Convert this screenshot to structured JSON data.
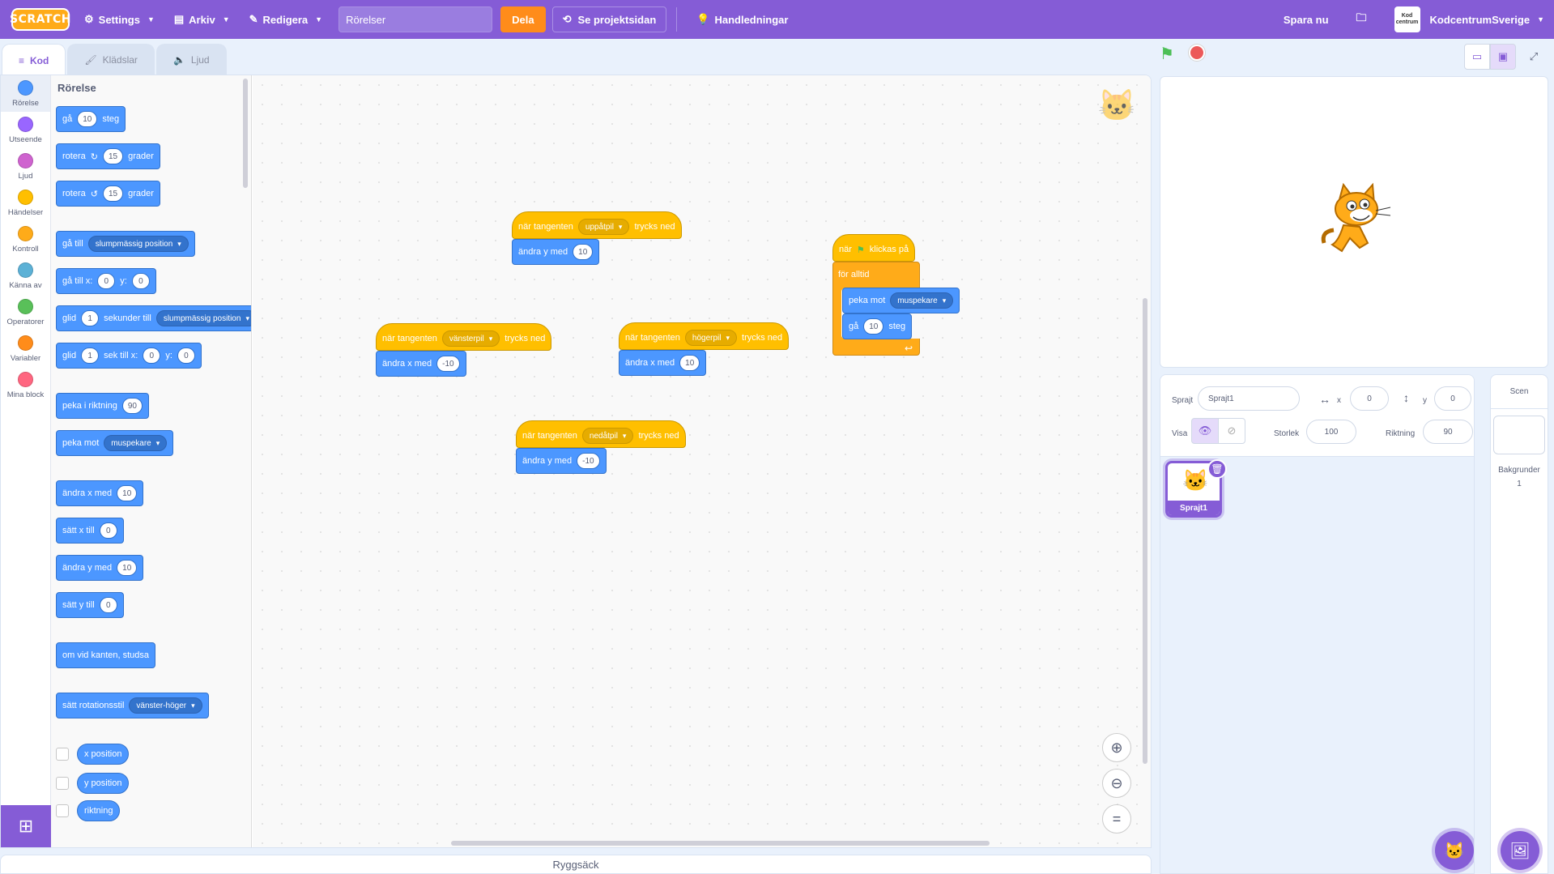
{
  "menubar": {
    "logo": "SCRATCH",
    "settings": "Settings",
    "file": "Arkiv",
    "edit": "Redigera",
    "title_value": "Rörelser",
    "share": "Dela",
    "project_page": "Se projektsidan",
    "tutorials": "Handledningar",
    "save_now": "Spara nu",
    "username": "KodcentrumSverige",
    "avatar_text": "Kod centrum"
  },
  "tabs": {
    "code": "Kod",
    "costumes": "Klädslar",
    "sounds": "Ljud"
  },
  "categories": [
    {
      "label": "Rörelse",
      "color": "#4c97ff"
    },
    {
      "label": "Utseende",
      "color": "#9966ff"
    },
    {
      "label": "Ljud",
      "color": "#cf63cf"
    },
    {
      "label": "Händelser",
      "color": "#ffbf00"
    },
    {
      "label": "Kontroll",
      "color": "#ffab19"
    },
    {
      "label": "Känna av",
      "color": "#5cb1d6"
    },
    {
      "label": "Operatorer",
      "color": "#59c059"
    },
    {
      "label": "Variabler",
      "color": "#ff8c1a"
    },
    {
      "label": "Mina block",
      "color": "#ff6680"
    }
  ],
  "palette": {
    "title": "Rörelse",
    "move": {
      "a": "gå",
      "v": "10",
      "b": "steg"
    },
    "turn_right": {
      "a": "rotera",
      "v": "15",
      "b": "grader"
    },
    "turn_left": {
      "a": "rotera",
      "v": "15",
      "b": "grader"
    },
    "goto": {
      "a": "gå till",
      "d": "slumpmässig position"
    },
    "goto_xy": {
      "a": "gå till x:",
      "x": "0",
      "b": "y:",
      "y": "0"
    },
    "glide": {
      "a": "glid",
      "v": "1",
      "b": "sekunder till",
      "d": "slumpmässig position"
    },
    "glide_xy": {
      "a": "glid",
      "v": "1",
      "b": "sek till x:",
      "x": "0",
      "c": "y:",
      "y": "0"
    },
    "point_dir": {
      "a": "peka i riktning",
      "v": "90"
    },
    "point_towards": {
      "a": "peka mot",
      "d": "muspekare"
    },
    "change_x": {
      "a": "ändra x med",
      "v": "10"
    },
    "set_x": {
      "a": "sätt x till",
      "v": "0"
    },
    "change_y": {
      "a": "ändra y med",
      "v": "10"
    },
    "set_y": {
      "a": "sätt y till",
      "v": "0"
    },
    "bounce": "om vid kanten, studsa",
    "rot_style": {
      "a": "sätt rotationsstil",
      "d": "vänster-höger"
    },
    "xpos": "x position",
    "ypos": "y position",
    "direction": "riktning"
  },
  "scripts": {
    "up": {
      "when": "när tangenten",
      "key": "uppåtpil",
      "pressed": "trycks ned",
      "action": "ändra y med",
      "value": "10"
    },
    "left": {
      "when": "när tangenten",
      "key": "vänsterpil",
      "pressed": "trycks ned",
      "action": "ändra x med",
      "value": "-10"
    },
    "right": {
      "when": "när tangenten",
      "key": "högerpil",
      "pressed": "trycks ned",
      "action": "ändra x med",
      "value": "10"
    },
    "down": {
      "when": "när tangenten",
      "key": "nedåtpil",
      "pressed": "trycks ned",
      "action": "ändra y med",
      "value": "-10"
    },
    "flag": {
      "when": "när",
      "clicked": "klickas på",
      "forever": "för alltid",
      "point": "peka mot",
      "target": "muspekare",
      "move": "gå",
      "steps_value": "10",
      "steps": "steg"
    }
  },
  "backpack": "Ryggsäck",
  "sprite_info": {
    "sprite_label": "Sprajt",
    "sprite_name": "Sprajt1",
    "x_label": "x",
    "x_value": "0",
    "y_label": "y",
    "y_value": "0",
    "show_label": "Visa",
    "size_label": "Storlek",
    "size_value": "100",
    "direction_label": "Riktning",
    "direction_value": "90"
  },
  "sprites": [
    {
      "name": "Sprajt1"
    }
  ],
  "scene": {
    "title": "Scen",
    "backdrops_label": "Bakgrunder",
    "backdrops_count": "1"
  },
  "colors": {
    "accent": "#855cd6",
    "motion": "#4c97ff",
    "events": "#ffbf00",
    "control": "#ffab19",
    "share": "#ff8c1a"
  }
}
